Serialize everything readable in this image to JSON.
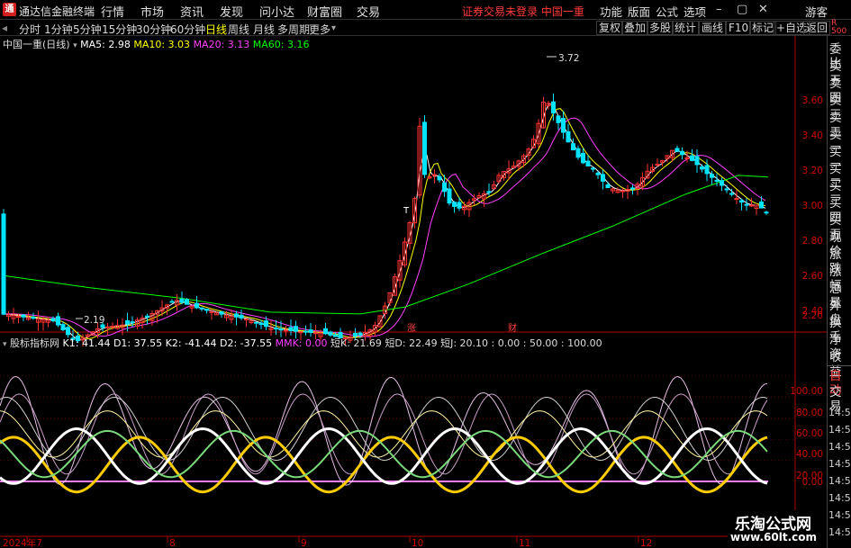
{
  "titlebar": {
    "app_title": "通达信金融终端",
    "menus": [
      "行情",
      "市场",
      "资讯",
      "发现",
      "问小达",
      "财富圈",
      "交易"
    ],
    "notice": "证券交易未登录 中国一重",
    "right_menus": [
      "功能",
      "版面",
      "公式",
      "选项"
    ],
    "guest": "游客"
  },
  "toolbar": {
    "periods": [
      "分时",
      "1分钟",
      "5分钟",
      "15分钟",
      "30分钟",
      "60分钟",
      "日线",
      "周线",
      "月线",
      "多周期",
      "更多"
    ],
    "active": "日线",
    "right_buttons": [
      "复权",
      "叠加",
      "多股",
      "统计",
      "画线",
      "F10",
      "标记",
      "+自选",
      "返回"
    ]
  },
  "price_legend": {
    "name": "中国一重(日线)",
    "ma5": "MA5: 2.98",
    "ma10": "MA10: 3.03",
    "ma20": "MA20: 3.13",
    "ma60": "MA60: 3.16"
  },
  "price_axis_labels": [
    "3.60",
    "3.40",
    "3.20",
    "3.00",
    "2.80",
    "2.60",
    "2.40",
    "2.20"
  ],
  "price_annotations": {
    "high": "3.72",
    "low": "2.19",
    "t_mark": "T",
    "zhang": "涨",
    "cai": "财"
  },
  "indicator_legend": {
    "name": "股标指标网",
    "k1": "K1: 41.44",
    "d1": "D1: 37.55",
    "k2": "K2: -41.44",
    "d2": "D2: -37.55",
    "mmk": "MMK: 0.00",
    "duank": "短K: 21.69",
    "duand": "短D: 22.49",
    "duanj": "短J: 20.10",
    "levels": ": 0.00 : 50.00 : 100.00"
  },
  "indicator_axis_labels": [
    "100.00",
    "80.00",
    "60.00",
    "40.00",
    "20.00",
    "0.00"
  ],
  "date_axis": [
    "2024年7",
    "8",
    "9",
    "10",
    "11",
    "12"
  ],
  "right_panel": {
    "badge": "R",
    "badge_num": "500",
    "items": [
      "委比",
      "卖五",
      "卖四",
      "卖三",
      "卖二",
      "卖一",
      "买一",
      "买二",
      "买三",
      "买四",
      "买五",
      "现价",
      "涨跌",
      "涨幅",
      "总量",
      "外盘",
      "换手",
      "净资",
      "收益"
    ],
    "auto": "自动",
    "trade": "交易",
    "times": [
      "14:56",
      "14:56",
      "14:56",
      "14:56",
      "14:56",
      "14:56",
      "14:56",
      "14:56"
    ]
  },
  "watermark": {
    "line1": "乐淘公式网",
    "line2": "www.60lt.com"
  },
  "colors": {
    "up": "#ff3232",
    "down": "#00e4ff",
    "ma5": "#ffffff",
    "ma10": "#ffff00",
    "ma20": "#ff40ff",
    "ma60": "#00ff00",
    "axis": "#b00000",
    "zero_line": "#ff80ff"
  }
}
